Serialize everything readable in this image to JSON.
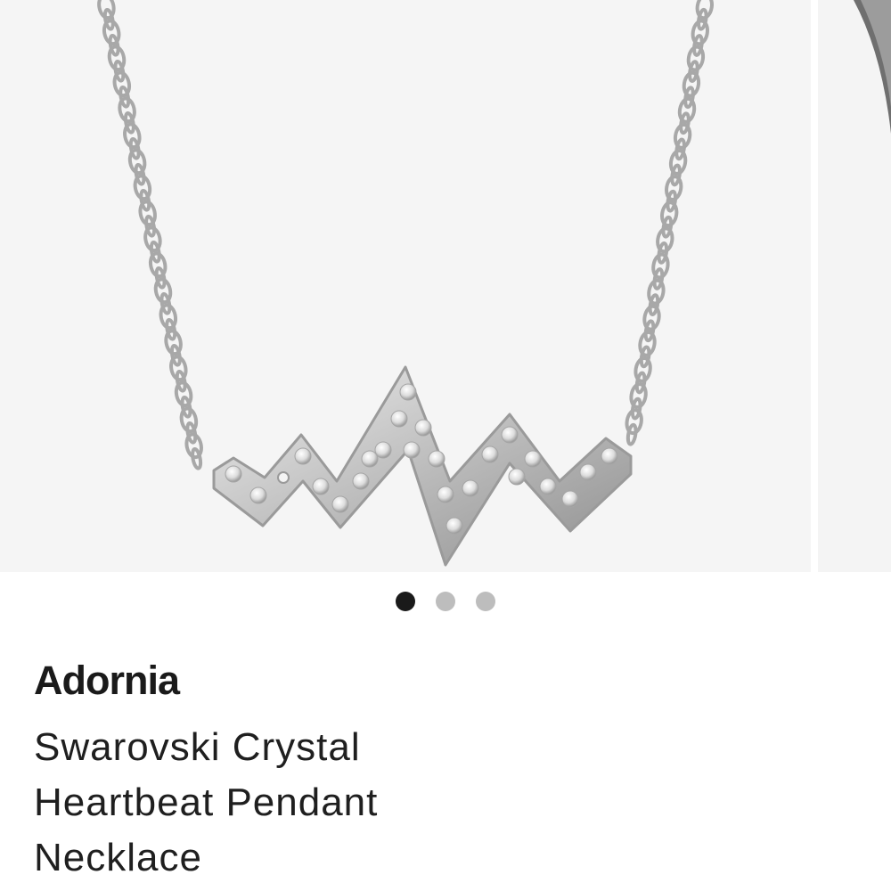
{
  "carousel": {
    "main_image": "heartbeat-pendant-necklace-photo",
    "dots": [
      {
        "state": "active"
      },
      {
        "state": "inactive"
      },
      {
        "state": "inactive"
      }
    ],
    "colors": {
      "active_dot": "#1a1a1a",
      "inactive_dot": "#bdbdbd",
      "image_background": "#f5f5f5"
    }
  },
  "product": {
    "brand": "Adornia",
    "name": "Swarovski Crystal Heartbeat Pendant Necklace"
  }
}
